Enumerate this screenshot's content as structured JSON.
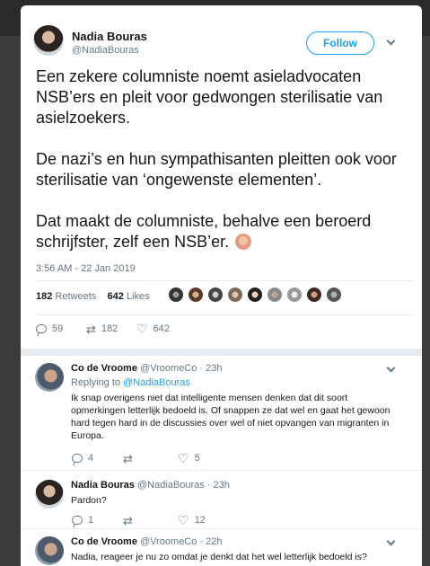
{
  "tweet": {
    "author_name": "Nadia Bouras",
    "author_handle": "@NadiaBouras",
    "follow_label": "Follow",
    "paragraphs": [
      "Een zekere columniste noemt asieladvocaten NSB’ers en pleit voor gedwongen sterilisatie van asielzoekers.",
      "De nazi’s en hun sympathisanten pleitten ook voor sterilisatie van ‘ongewenste elementen’.",
      "Dat maakt de columniste, behalve een beroerd schrijfster, zelf een NSB’er."
    ],
    "timestamp": "3:56 AM - 22 Jan 2019",
    "retweets_count": "182",
    "retweets_label": "Retweets",
    "likes_count": "642",
    "likes_label": "Likes",
    "actions": {
      "replies": "59",
      "retweets": "182",
      "likes": "642"
    }
  },
  "replies": [
    {
      "name": "Co de Vroome",
      "handle_time": "@VroomeCo · 23h",
      "replying_prefix": "Replying to",
      "replying_to": "@NadiaBouras",
      "text": "Ik snap overigens niet dat intelligente mensen denken dat dit soort opmerkingen letterlijk bedoeld is. Of snappen ze dat wel en gaat het gewoon hard tegen hard in de discussies over wel of niet opvangen van migranten in Europa.",
      "reply_count": "4",
      "retweet_count": "",
      "like_count": "5"
    },
    {
      "name": "Nadia Bouras",
      "handle_time": "@NadiaBouras · 23h",
      "text": "Pardon?",
      "reply_count": "1",
      "retweet_count": "",
      "like_count": "12"
    },
    {
      "name": "Co de Vroome",
      "handle_time": "@VroomeCo · 22h",
      "text": "Nadia, reageer je nu zo omdat je denkt dat het wel letterlijk bedoeld is?"
    }
  ],
  "colors": {
    "accent": "#1da1f2",
    "muted": "#657786",
    "text": "#14171a",
    "divider": "#e6ecf0"
  },
  "icons": [
    "reply-icon",
    "retweet-icon",
    "like-icon",
    "chevron-down-icon",
    "shrug-emoji-icon"
  ]
}
